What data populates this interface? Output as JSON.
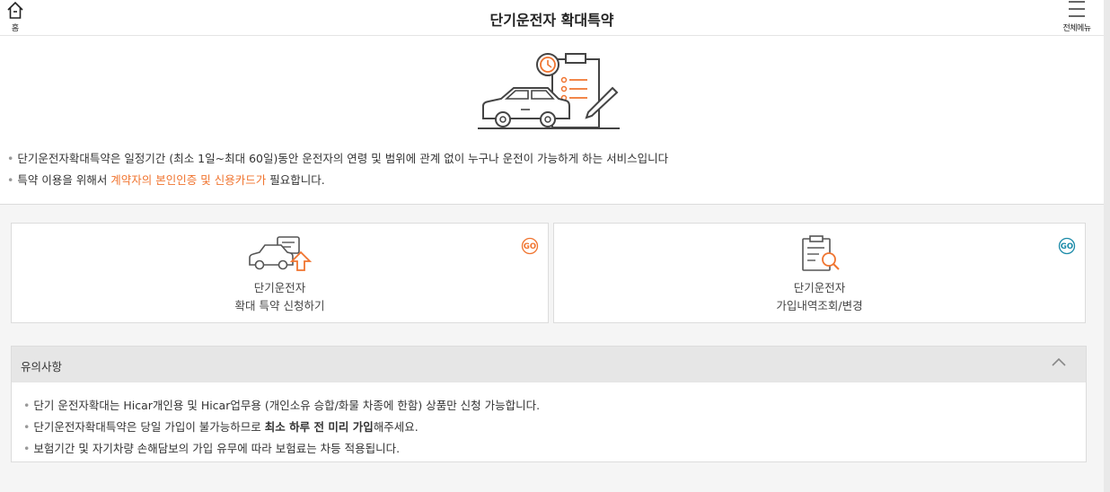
{
  "header": {
    "home_label": "홈",
    "title": "단기운전자 확대특약",
    "menu_label": "전체메뉴"
  },
  "intro": {
    "line1": "단기운전자확대특약은 일정기간 (최소 1일~최대 60일)동안 운전자의 연령 및 범위에 관계 없이 누구나 운전이 가능하게 하는 서비스입니다",
    "line2_before": "특약 이용을 위해서 ",
    "line2_highlight": "계약자의 본인인증 및 신용카드가",
    "line2_after": " 필요합니다."
  },
  "cards": [
    {
      "line1": "단기운전자",
      "line2": "확대 특약 신청하기",
      "go_label": "GO"
    },
    {
      "line1": "단기운전자",
      "line2": "가입내역조회/변경",
      "go_label": "GO"
    }
  ],
  "notice": {
    "title": "유의사항",
    "item1": "단기 운전자확대는 Hicar개인용 및 Hicar업무용 (개인소유 승합/화물 차종에 한함) 상품만 신청 가능합니다.",
    "item2_before": "단기운전자확대특약은 당일 가입이 불가능하므로 ",
    "item2_bold": "최소 하루 전 미리 가입",
    "item2_after": "해주세요.",
    "item3": "보험기간 및 자기차량 손해담보의 가입 유무에 따라 보험료는 차등 적용됩니다."
  },
  "colors": {
    "accent_orange": "#f0742f",
    "accent_teal": "#1a8aa8",
    "notice_header_bg": "#e6e6e6"
  },
  "icons": {
    "home": "home-icon",
    "menu": "hamburger-menu-icon",
    "hero": "car-document-illustration",
    "card1": "car-upgrade-icon",
    "card2": "clipboard-search-icon",
    "toggle": "chevron-up-icon"
  }
}
